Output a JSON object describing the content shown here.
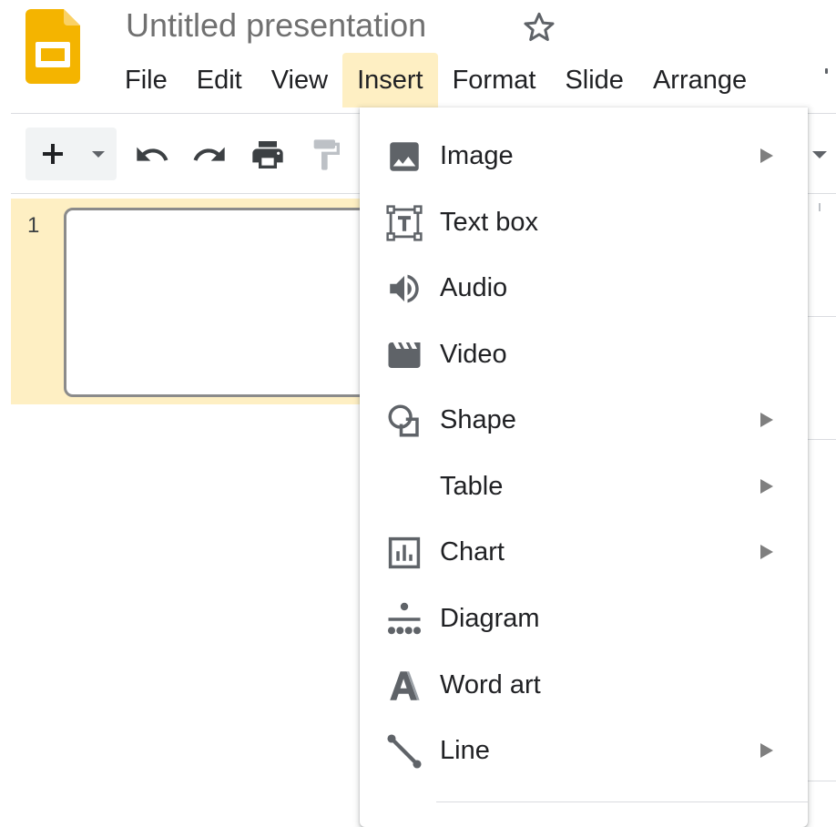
{
  "app": {
    "document_title": "Untitled presentation",
    "accent_color": "#f4b400",
    "menu_active_color": "#feefc3"
  },
  "menubar": {
    "items": [
      {
        "label": "File"
      },
      {
        "label": "Edit"
      },
      {
        "label": "View"
      },
      {
        "label": "Insert",
        "active": true
      },
      {
        "label": "Format"
      },
      {
        "label": "Slide"
      },
      {
        "label": "Arrange"
      }
    ]
  },
  "toolbar": {
    "icons": [
      "add-icon",
      "dropdown-arrow-icon",
      "undo-icon",
      "redo-icon",
      "print-icon",
      "paint-format-icon"
    ]
  },
  "filmstrip": {
    "slides": [
      {
        "number": "1",
        "selected": true
      }
    ]
  },
  "insert_menu": {
    "items": [
      {
        "label": "Image",
        "icon": "image-icon",
        "submenu": true
      },
      {
        "label": "Text box",
        "icon": "text-box-icon",
        "submenu": false
      },
      {
        "label": "Audio",
        "icon": "audio-icon",
        "submenu": false
      },
      {
        "label": "Video",
        "icon": "video-icon",
        "submenu": false
      },
      {
        "label": "Shape",
        "icon": "shape-icon",
        "submenu": true
      },
      {
        "label": "Table",
        "icon": "",
        "submenu": true
      },
      {
        "label": "Chart",
        "icon": "chart-icon",
        "submenu": true
      },
      {
        "label": "Diagram",
        "icon": "diagram-icon",
        "submenu": false
      },
      {
        "label": "Word art",
        "icon": "word-art-icon",
        "submenu": false
      },
      {
        "label": "Line",
        "icon": "line-icon",
        "submenu": true
      }
    ]
  }
}
